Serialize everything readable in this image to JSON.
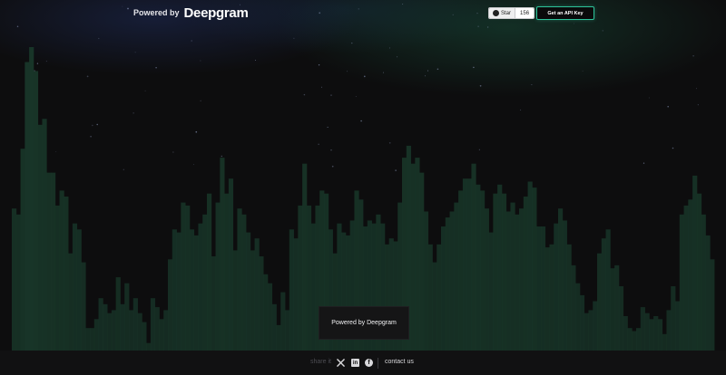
{
  "header": {
    "brand_prefix": "Powered by",
    "brand_name": "Deepgram",
    "github": {
      "label": "Star",
      "count": "156",
      "icon": "github-icon"
    },
    "cta_label": "Get an API Key",
    "accent_color": "#2dc39a"
  },
  "visualizer": {
    "bar_color": "#183528",
    "levels": [
      0.46,
      0.44,
      0.66,
      0.95,
      1.0,
      0.92,
      0.74,
      0.76,
      0.58,
      0.58,
      0.47,
      0.52,
      0.5,
      0.31,
      0.41,
      0.39,
      0.28,
      0.06,
      0.06,
      0.09,
      0.16,
      0.14,
      0.11,
      0.12,
      0.23,
      0.14,
      0.21,
      0.12,
      0.16,
      0.11,
      0.08,
      0.01,
      0.16,
      0.13,
      0.09,
      0.12,
      0.29,
      0.39,
      0.38,
      0.48,
      0.47,
      0.39,
      0.37,
      0.41,
      0.44,
      0.51,
      0.3,
      0.48,
      0.63,
      0.51,
      0.56,
      0.32,
      0.46,
      0.44,
      0.38,
      0.32,
      0.36,
      0.3,
      0.24,
      0.21,
      0.14,
      0.07,
      0.18,
      0.12,
      0.39,
      0.36,
      0.47,
      0.61,
      0.47,
      0.41,
      0.47,
      0.52,
      0.51,
      0.39,
      0.31,
      0.41,
      0.38,
      0.37,
      0.42,
      0.52,
      0.49,
      0.4,
      0.42,
      0.41,
      0.44,
      0.41,
      0.34,
      0.36,
      0.35,
      0.48,
      0.63,
      0.67,
      0.61,
      0.63,
      0.58,
      0.45,
      0.34,
      0.28,
      0.34,
      0.4,
      0.43,
      0.45,
      0.48,
      0.52,
      0.56,
      0.56,
      0.61,
      0.54,
      0.52,
      0.46,
      0.38,
      0.51,
      0.54,
      0.51,
      0.45,
      0.48,
      0.44,
      0.46,
      0.5,
      0.55,
      0.53,
      0.4,
      0.4,
      0.33,
      0.34,
      0.41,
      0.46,
      0.42,
      0.34,
      0.27,
      0.21,
      0.17,
      0.11,
      0.12,
      0.15,
      0.31,
      0.36,
      0.39,
      0.26,
      0.27,
      0.2,
      0.1,
      0.06,
      0.05,
      0.06,
      0.13,
      0.11,
      0.09,
      0.1,
      0.09,
      0.04,
      0.12,
      0.2,
      0.15,
      0.44,
      0.47,
      0.49,
      0.57,
      0.51,
      0.44,
      0.37,
      0.29
    ]
  },
  "center_label": "Powered by Deepgram",
  "footer": {
    "share_label": "share it",
    "social_icons": [
      "x-icon",
      "linkedin-icon",
      "facebook-icon"
    ],
    "contact_label": "contact us"
  }
}
